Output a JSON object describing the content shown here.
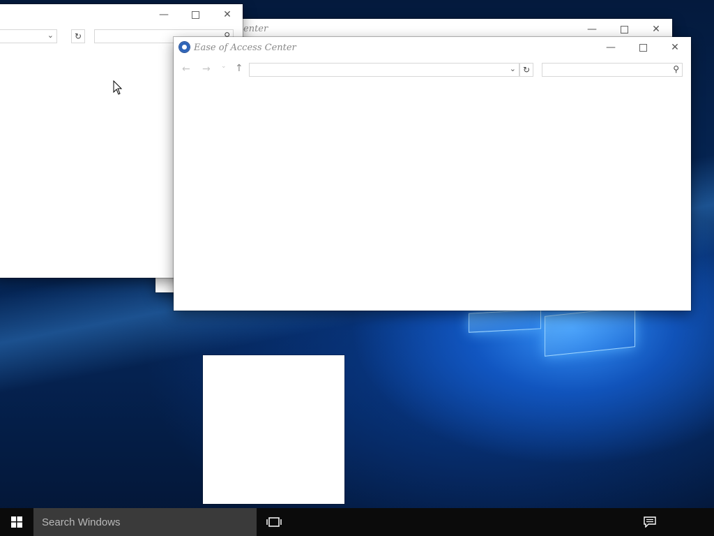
{
  "desktop": {
    "wallpaper": "windows-10-hero"
  },
  "windows": {
    "back": {
      "title_fragment": "enter",
      "minimize_icon": "minimize-icon",
      "maximize_icon": "maximize-icon",
      "close_icon": "close-icon"
    },
    "left": {
      "refresh_icon": "refresh-icon",
      "search_icon": "search-icon"
    },
    "front": {
      "title": "Ease of Access Center",
      "app_icon": "ease-of-access-icon",
      "address_value": "",
      "search_value": ""
    }
  },
  "taskbar": {
    "start_icon": "windows-logo-icon",
    "search_placeholder": "Search Windows",
    "task_view_icon": "task-view-icon",
    "action_center_icon": "action-center-icon"
  },
  "colors": {
    "taskbar_bg": "#0b0b0b",
    "search_bg": "#3a3a3a",
    "window_bg": "#ffffff",
    "wallpaper_accent": "#1e78e6"
  }
}
